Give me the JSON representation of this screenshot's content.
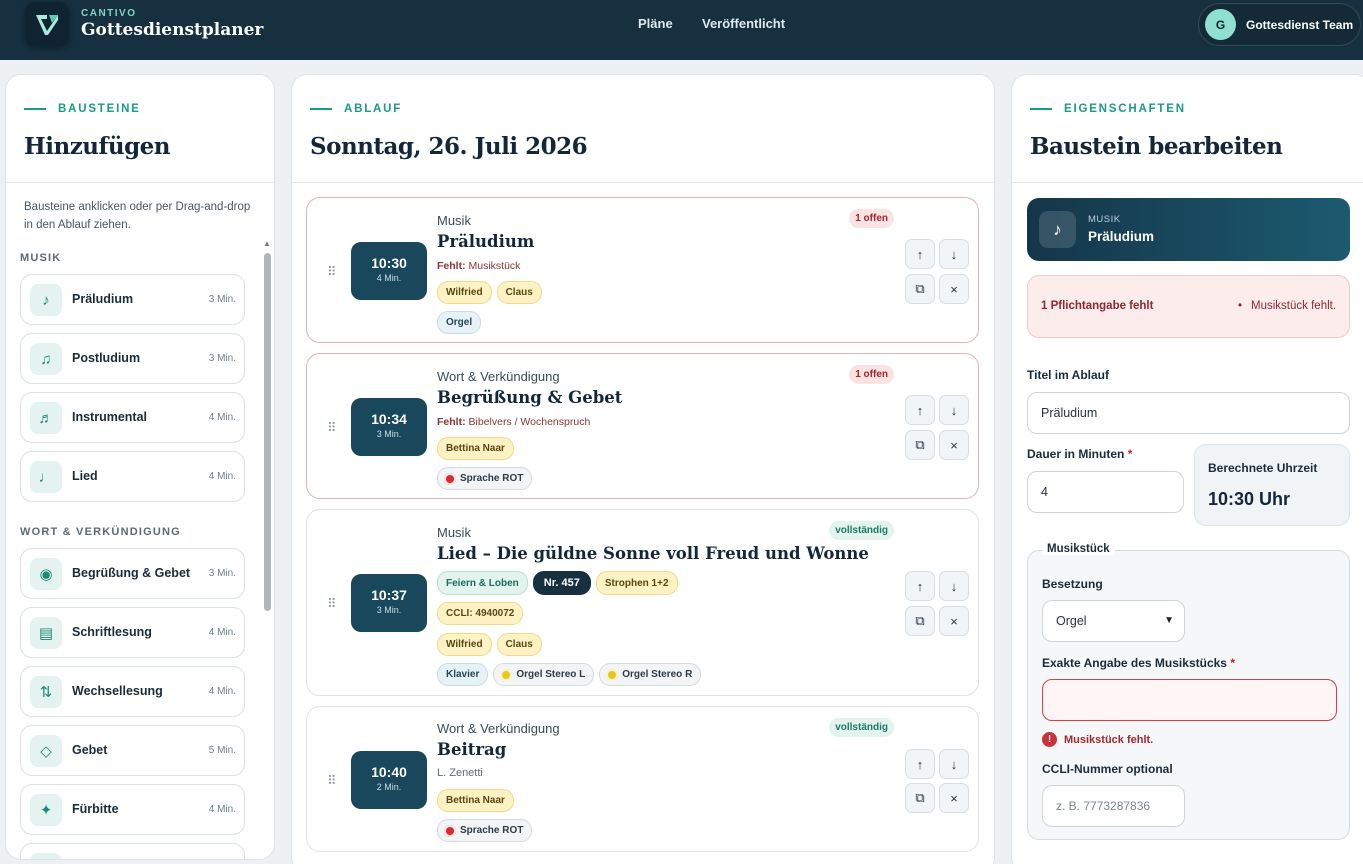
{
  "app": {
    "brand_small": "CANTIVO",
    "brand_name": "Gottesdienstplaner"
  },
  "nav": {
    "plans": "Pläne",
    "published": "Veröffentlicht"
  },
  "user": {
    "initial": "G",
    "name": "Gottesdienst Team"
  },
  "left": {
    "eyebrow": "BAUSTEINE",
    "title": "Hinzufügen",
    "hint": "Bausteine anklicken oder per Drag-and-drop in den Ablauf ziehen.",
    "categories": [
      {
        "label": "MUSIK",
        "items": [
          {
            "icon": "♪",
            "label": "Präludium",
            "min": "3 Min."
          },
          {
            "icon": "♫",
            "label": "Postludium",
            "min": "3 Min."
          },
          {
            "icon": "♬",
            "label": "Instrumental",
            "min": "4 Min."
          },
          {
            "icon": "♩",
            "label": "Lied",
            "min": "4 Min."
          }
        ]
      },
      {
        "label": "WORT & VERKÜNDIGUNG",
        "items": [
          {
            "icon": "◉",
            "label": "Begrüßung & Gebet",
            "min": "3 Min."
          },
          {
            "icon": "▤",
            "label": "Schriftlesung",
            "min": "4 Min."
          },
          {
            "icon": "⇅",
            "label": "Wechsellesung",
            "min": "4 Min."
          },
          {
            "icon": "◇",
            "label": "Gebet",
            "min": "5 Min."
          },
          {
            "icon": "✦",
            "label": "Fürbitte",
            "min": "4 Min."
          }
        ]
      }
    ]
  },
  "middle": {
    "eyebrow": "ABLAUF",
    "title": "Sonntag, 26. Juli 2026",
    "cards": [
      {
        "type": "Musik",
        "title": "Präludium",
        "time": "10:30",
        "duration": "4 Min.",
        "status": "1 offen",
        "missing_label": "Fehlt:",
        "missing_text": "Musikstück",
        "people": [
          "Wilfried",
          "Claus"
        ],
        "channels": [
          "Orgel"
        ]
      },
      {
        "type": "Wort & Verkündigung",
        "title": "Begrüßung & Gebet",
        "time": "10:34",
        "duration": "3 Min.",
        "status": "1 offen",
        "missing_label": "Fehlt:",
        "missing_text": "Bibelvers / Wochenspruch",
        "people": [
          "Bettina Naar"
        ],
        "channels": [
          "Sprache ROT"
        ]
      },
      {
        "type": "Musik",
        "title": "Lied – Die güldne Sonne voll Freud und Wonne",
        "time": "10:37",
        "duration": "3 Min.",
        "status": "vollständig",
        "song_meta": [
          "Feiern & Loben",
          "Nr. 457",
          "Strophen 1+2"
        ],
        "ccli": "CCLI: 4940072",
        "people": [
          "Wilfried",
          "Claus"
        ],
        "channels": [
          "Klavier",
          "Orgel Stereo L",
          "Orgel Stereo R"
        ]
      },
      {
        "type": "Wort & Verkündigung",
        "title": "Beitrag",
        "time": "10:40",
        "duration": "2 Min.",
        "status": "vollständig",
        "speaker": "L. Zenetti",
        "people": [
          "Bettina Naar"
        ],
        "channels": [
          "Sprache ROT"
        ]
      }
    ],
    "controls": {
      "up": "↑",
      "down": "↓",
      "duplicate": "⧉",
      "remove": "×"
    }
  },
  "right": {
    "eyebrow": "EIGENSCHAFTEN",
    "title": "Baustein bearbeiten",
    "selected": {
      "type": "MUSIK",
      "title": "Präludium",
      "icon": "♪"
    },
    "alert": {
      "main": "1 Pflichtangabe fehlt",
      "item": "Musikstück fehlt."
    },
    "title_label": "Titel im Ablauf",
    "title_value": "Präludium",
    "duration_label": "Dauer in Minuten",
    "duration_value": "4",
    "calc_label": "Berechnete Uhrzeit",
    "calc_value": "10:30 Uhr",
    "fieldset_legend": "Musikstück",
    "besetzung_label": "Besetzung",
    "besetzung_value": "Orgel",
    "piece_label": "Exakte Angabe des Musikstücks",
    "piece_value": "",
    "piece_error": "Musikstück fehlt.",
    "ccli_label": "CCLI-Nummer optional",
    "ccli_placeholder": "z. B. 7773287836"
  },
  "colors": {
    "topbar": "#16303f",
    "accent": "#1a9a87",
    "time_box": "#19475b",
    "error": "#c0262f"
  }
}
